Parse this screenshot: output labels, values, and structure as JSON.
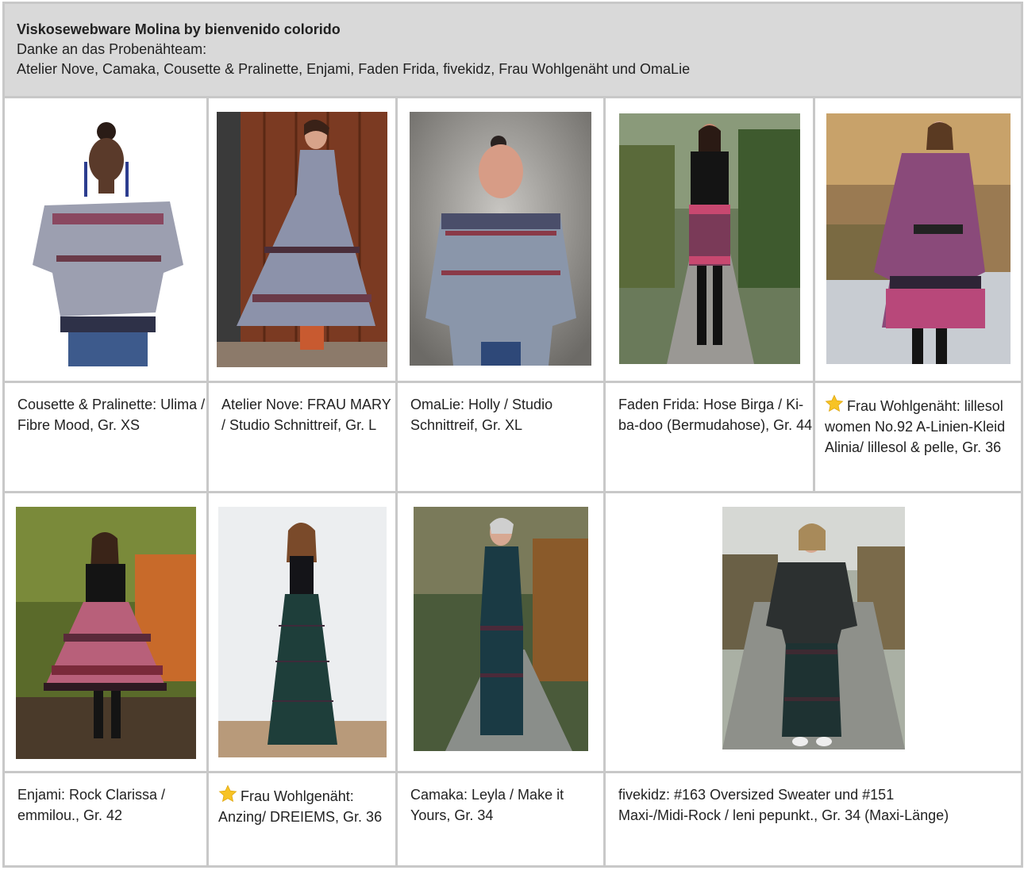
{
  "header": {
    "title": "Viskosewebware Molina by bienvenido colorido",
    "line1": "Danke an das Probenähteam:",
    "line2": "Atelier Nove, Camaka, Cousette & Pralinette, Enjami, Faden Frida, fivekidz, Frau Wohlgenäht und OmaLie"
  },
  "row1": [
    {
      "caption": "Cousette & Pralinette: Ulima / Fibre Mood, Gr. XS",
      "starred": false
    },
    {
      "caption": "Atelier Nove: FRAU MARY / Studio Schnittreif, Gr. L",
      "starred": false
    },
    {
      "caption": "OmaLie: Holly / Studio Schnittreif, Gr. XL",
      "starred": false
    },
    {
      "caption": "Faden Frida: Hose Birga / Ki-ba-doo (Bermudahose), Gr. 44",
      "starred": false
    },
    {
      "caption": "Frau Wohlgenäht: lillesol women No.92 A-Linien-Kleid Alinia/ lillesol & pelle, Gr. 36",
      "starred": true
    }
  ],
  "row2": [
    {
      "caption": "Enjami: Rock Clarissa / emmilou., Gr. 42",
      "starred": false
    },
    {
      "caption": "Frau Wohlgenäht: Anzing/ DREIEMS, Gr. 36",
      "starred": true
    },
    {
      "caption": "Camaka: Leyla / Make it Yours, Gr. 34",
      "starred": false
    },
    {
      "caption": "fivekidz: #163 Oversized Sweater und #151 Maxi-/Midi-Rock / leni pepunkt., Gr. 34 (Maxi-Länge)",
      "starred": false
    }
  ],
  "colors": {
    "header_bg": "#d9d9d9",
    "border": "#c8c8c8",
    "star": "#f7c325"
  }
}
